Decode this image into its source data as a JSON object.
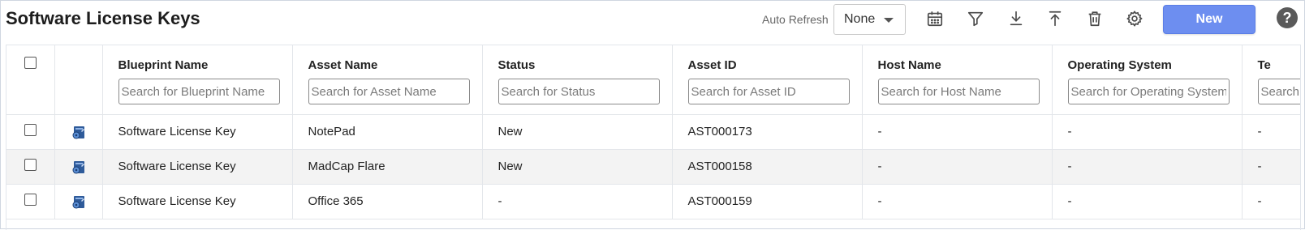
{
  "header": {
    "title": "Software License Keys",
    "auto_refresh_label": "Auto Refresh",
    "auto_refresh_value": "None",
    "new_label": "New",
    "help_label": "?"
  },
  "toolbar_icons": [
    "calendar-icon",
    "filter-icon",
    "download-icon",
    "upload-icon",
    "delete-icon",
    "settings-icon"
  ],
  "columns": [
    {
      "label": "Blueprint Name",
      "placeholder": "Search for Blueprint Name"
    },
    {
      "label": "Asset Name",
      "placeholder": "Search for Asset Name"
    },
    {
      "label": "Status",
      "placeholder": "Search for Status"
    },
    {
      "label": "Asset ID",
      "placeholder": "Search for Asset ID"
    },
    {
      "label": "Host Name",
      "placeholder": "Search for Host Name"
    },
    {
      "label": "Operating System",
      "placeholder": "Search for Operating System"
    },
    {
      "label": "Te",
      "placeholder": "Search"
    }
  ],
  "rows": [
    {
      "blueprint": "Software License Key",
      "asset_name": "NotePad",
      "status": "New",
      "asset_id": "AST000173",
      "host": "-",
      "os": "-",
      "te": "-"
    },
    {
      "blueprint": "Software License Key",
      "asset_name": "MadCap Flare",
      "status": "New",
      "asset_id": "AST000158",
      "host": "-",
      "os": "-",
      "te": "-"
    },
    {
      "blueprint": "Software License Key",
      "asset_name": "Office 365",
      "status": "-",
      "asset_id": "AST000159",
      "host": "-",
      "os": "-",
      "te": "-"
    }
  ],
  "colors": {
    "accent": "#6d8ef0",
    "alt_row": "#f3f3f3",
    "icon": "#4a4a4a"
  }
}
